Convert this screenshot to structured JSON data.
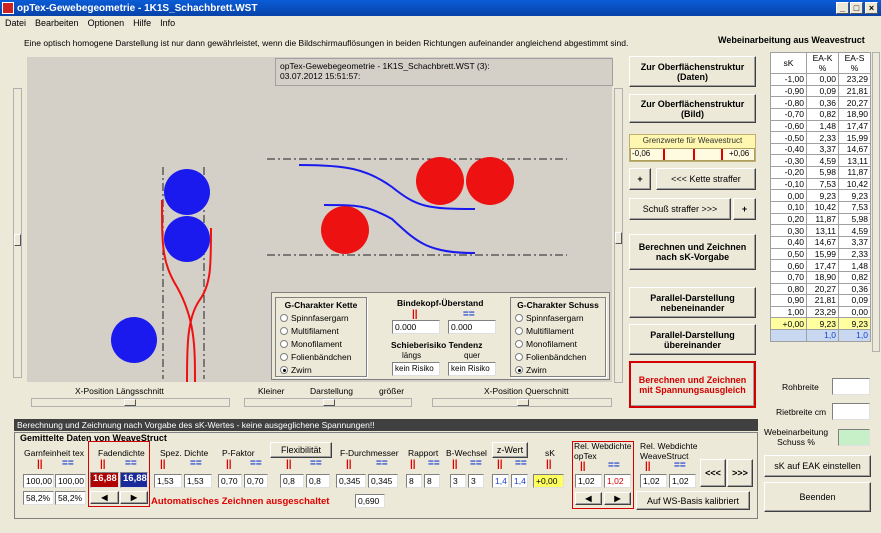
{
  "window": {
    "title": "opTex-Gewebegeometrie - 1K1S_Schachbrett.WST"
  },
  "menu": [
    "Datei",
    "Bearbeiten",
    "Optionen",
    "Hilfe",
    "Info"
  ],
  "notice": "Eine optisch homogene Darstellung ist nur dann gewährleistet, wenn die Bildschirmauflösungen in  beiden Richtungen aufeinander angleichend abgestimmt sind.",
  "canvas": {
    "info_line1": "opTex-Gewebegeometrie - 1K1S_Schachbrett.WST (3):",
    "info_line2": "03.07.2012 15:51:57:"
  },
  "g_kette": {
    "title": "G-Charakter Kette",
    "options": [
      "Spinnfasergarn",
      "Multifilament",
      "Monofilament",
      "Folienbändchen",
      "Zwirn"
    ],
    "selected": 4
  },
  "g_schuss": {
    "title": "G-Charakter Schuss",
    "options": [
      "Spinnfasergarn",
      "Multifilament",
      "Monofilament",
      "Folienbändchen",
      "Zwirn"
    ],
    "selected": 4
  },
  "bindekopf": {
    "title": "Bindekopf-Überstand",
    "v1": "0.000",
    "v2": "0.000",
    "mark1": "||",
    "mark2": "=="
  },
  "schieberisiko": {
    "title": "Schieberisiko Tendenz",
    "sub1": "längs",
    "sub2": "quer",
    "v1": "kein Risiko",
    "v2": "kein Risiko"
  },
  "sliders": {
    "x_laengs": "X-Position Längsschnitt",
    "kleiner": "Kleiner",
    "darstellung": "Darstellung",
    "groesser": "größer",
    "x_quer": "X-Position Querschnitt"
  },
  "buttons": {
    "oberflaeche_daten": "Zur Oberflächenstruktur (Daten)",
    "oberflaeche_bild": "Zur Oberflächenstruktur (Bild)",
    "kette_straffer": "<<< Kette straffer",
    "schuss_straffer": "Schuß straffer >>>",
    "plus1": "+",
    "plus2": "+",
    "berechnen_sk": "Berechnen und Zeichnen nach sK-Vorgabe",
    "parallel_neben": "Parallel-Darstellung nebeneinander",
    "parallel_ueber": "Parallel-Darstellung übereinander",
    "berechnen_spannung": "Berechnen und Zeichnen mit Spannungsausgleich",
    "sk_eak": "sK auf EAK einstellen",
    "beenden": "Beenden",
    "flexibilitaet": "Flexibilität",
    "z_wert": "z-Wert",
    "ws_basis": "Auf WS-Basis kalibriert",
    "prev": "<<<",
    "next": ">>>"
  },
  "grenzwerte": {
    "title": "Grenzwerte für Weavestruct",
    "left": "-0,06",
    "right": "+0,06"
  },
  "webeinarbeitung": {
    "title": "Webeinarbeitung aus Weavestruct",
    "headers": [
      "sK",
      "EA-K %",
      "EA-S %"
    ],
    "rows": [
      [
        "-1,00",
        "0,00",
        "23,29"
      ],
      [
        "-0,90",
        "0,09",
        "21,81"
      ],
      [
        "-0,80",
        "0,36",
        "20,27"
      ],
      [
        "-0,70",
        "0,82",
        "18,90"
      ],
      [
        "-0,60",
        "1,48",
        "17,47"
      ],
      [
        "-0,50",
        "2,33",
        "15,99"
      ],
      [
        "-0,40",
        "3,37",
        "14,67"
      ],
      [
        "-0,30",
        "4,59",
        "13,11"
      ],
      [
        "-0,20",
        "5,98",
        "11,87"
      ],
      [
        "-0,10",
        "7,53",
        "10,42"
      ],
      [
        "0,00",
        "9,23",
        "9,23"
      ],
      [
        "0,10",
        "10,42",
        "7,53"
      ],
      [
        "0,20",
        "11,87",
        "5,98"
      ],
      [
        "0,30",
        "13,11",
        "4,59"
      ],
      [
        "0,40",
        "14,67",
        "3,37"
      ],
      [
        "0,50",
        "15,99",
        "2,33"
      ],
      [
        "0,60",
        "17,47",
        "1,48"
      ],
      [
        "0,70",
        "18,90",
        "0,82"
      ],
      [
        "0,80",
        "20,27",
        "0,36"
      ],
      [
        "0,90",
        "21,81",
        "0,09"
      ],
      [
        "1,00",
        "23,29",
        "0,00"
      ]
    ],
    "current": [
      "+0,00",
      "9,23",
      "9,23"
    ],
    "last": [
      "",
      "1,0",
      "1,0"
    ]
  },
  "right_fields": {
    "rohbreite": "Rohbreite",
    "rietbreite": "Rietbreite cm",
    "webeinarbeitung_schuss": "Webeinarbeitung Schuss %"
  },
  "bottom": {
    "status": "Berechnung und Zeichnung nach Vorgabe des sK-Wertes - keine ausgeglichene Spannungen!!",
    "group_title": "Gemittelte Daten von WeaveStruct",
    "garnfeinheit": "Garnfeinheit  tex",
    "garn_v1": "100,00",
    "garn_v2": "100,00",
    "garn_p1": "58,2%",
    "garn_p2": "58,2%",
    "fadendichte": "Fadendichte",
    "faden_v1": "16,88",
    "faden_v2": "16,88",
    "spez_dichte": "Spez. Dichte",
    "spez_v1": "1,53",
    "spez_v2": "1,53",
    "p_faktor": "P-Faktor",
    "p_v1": "0,70",
    "p_v2": "0,70",
    "flex_v1": "0,8",
    "flex_v2": "0,8",
    "f_durchmesser": "F-Durchmesser",
    "fd_v1": "0,345",
    "fd_v2": "0,345",
    "fd_v3": "0,690",
    "rapport": "Rapport",
    "rap_v1": "8",
    "rap_v2": "8",
    "b_wechsel": "B-Wechsel",
    "bw_v1": "3",
    "bw_v2": "3",
    "z_v1": "1,4",
    "z_v2": "1,4",
    "sk": "sK",
    "sk_v": "+0,00",
    "rel_optex": "Rel. Webdichte opTex",
    "ro_v1": "1,02",
    "ro_v2": "1,02",
    "rel_ws": "Rel. Webdichte WeaveStruct",
    "rw_v1": "1,02",
    "rw_v2": "1,02",
    "auto_zeichnen": "Automatisches Zeichnen ausgeschaltet",
    "mark_k": "||",
    "mark_s": "=="
  },
  "colors": {
    "red": "#ee1111",
    "blue": "#1a1aee",
    "accent_red": "#d40000"
  }
}
